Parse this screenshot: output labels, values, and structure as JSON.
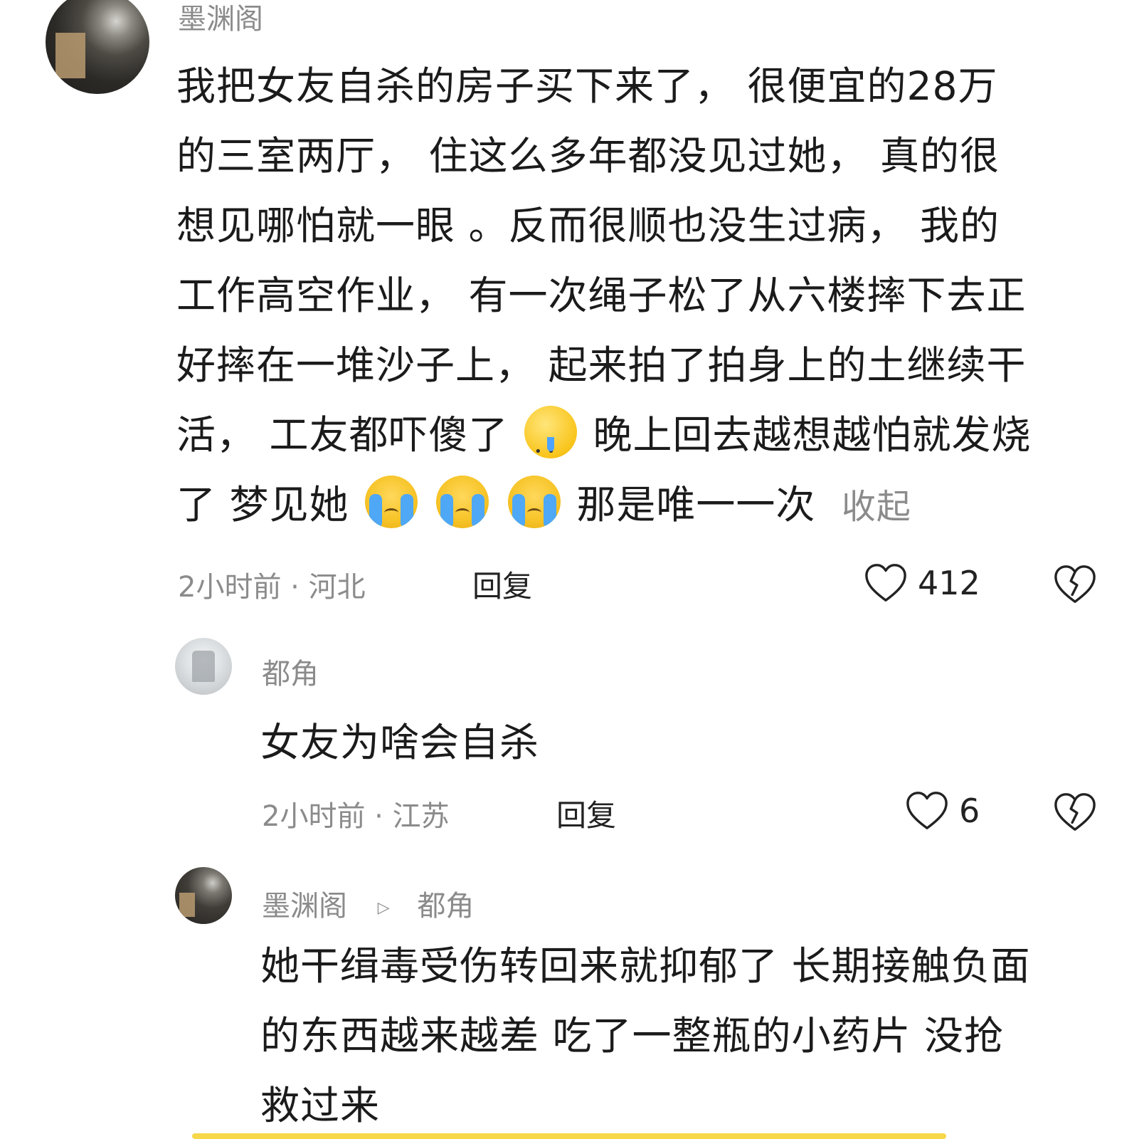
{
  "comments": [
    {
      "username": "墨渊阁",
      "lines": [
        "我把女友自杀的房子买下来了， 很便宜的28万",
        "的三室两厅， 住这么多年都没见过她， 真的很",
        "想见哪怕就一眼 。反而很顺也没生过病， 我的",
        "工作高空作业， 有一次绳子松了从六楼摔下去正",
        "好摔在一堆沙子上， 起来拍了拍身上的土继续干"
      ],
      "line6_a": "活， 工友都吓傻了",
      "line6_b": "晚上回去越想越怕就发烧",
      "line7_a": "了 梦见她",
      "line7_b": "那是唯一一次",
      "collapse": "收起",
      "meta": "2小时前 · 河北",
      "reply": "回复",
      "likes": "412",
      "emojis": [
        "drooling-face-emoji",
        "loudly-crying-face-emoji",
        "loudly-crying-face-emoji",
        "loudly-crying-face-emoji"
      ]
    },
    {
      "username": "都角",
      "lines": [
        "女友为啥会自杀"
      ],
      "meta": "2小时前 · 江苏",
      "reply": "回复",
      "likes": "6"
    },
    {
      "username": "墨渊阁",
      "reply_to": "都角",
      "lines": [
        "她干缉毒受伤转回来就抑郁了 长期接触负面",
        "的东西越来越差 吃了一整瓶的小药片 没抢",
        "救过来"
      ]
    }
  ],
  "colors": {
    "text": "#1b1b1b",
    "muted": "#8b8b8b",
    "bottom_bar": "#f6d84a"
  }
}
